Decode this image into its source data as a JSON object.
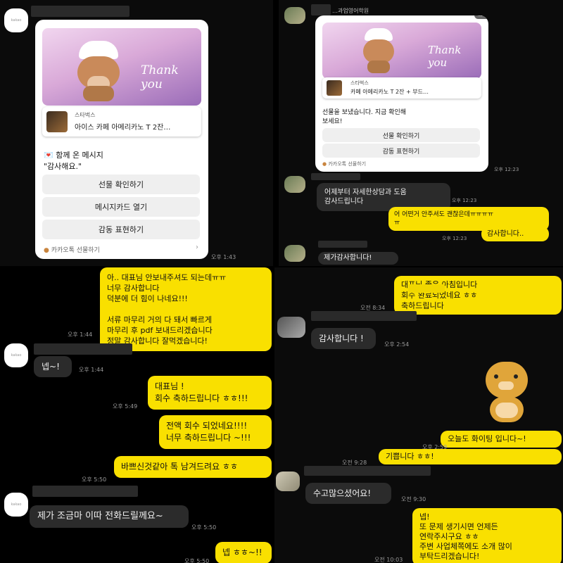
{
  "top_left": {
    "card": {
      "badge": "kakao",
      "thank_you": "Thank you",
      "brand": "스타벅스",
      "product": "아이스 카페 아메리카노 T 2잔…",
      "message_heading": "함께 온 메시지",
      "message_text": "\"감사해요.\"",
      "buttons": [
        "선물 확인하기",
        "메시지카드 열기",
        "감동 표현하기"
      ],
      "footer": "카카오톡 선물하기"
    },
    "card_time": "오후 1:43",
    "messages": [
      {
        "text": "아.. 대표님 안보내주셔도 되는데ㅠㅠ\n너무 감사합니다\n덕분에 더 힘이 나네요!!!\n\n서류 마무리 거의 다 돼서 빠르게\n마무리 후 pdf 보내드리겠습니다\n정말 감사합니다 잘먹겠습니다!",
        "time": "오후 1:44"
      },
      {
        "text": "넵~!",
        "time": "오후 1:44"
      }
    ]
  },
  "bottom_left": {
    "messages": [
      {
        "text": "대표님 !\n회수 축하드립니다 ㅎㅎ!!!",
        "time": "오후 5:49"
      },
      {
        "text": "전액 회수 되었네요!!!!\n너무 축하드립니다 ~!!!",
        "time": ""
      },
      {
        "text": "바쁘신것같아 톡 남겨드려요 ㅎㅎ",
        "time": "오후 5:50"
      },
      {
        "text": "제가 조금마 이따 전화드릴께요~",
        "time": "오후 5:50"
      },
      {
        "text": "넵 ㅎㅎ~!!",
        "time": "오후 5:50"
      }
    ]
  },
  "top_right": {
    "sender": "…과업영어학원",
    "card": {
      "badge": "kakao",
      "thank_you": "Thank you",
      "brand": "스타벅스",
      "product": "카페 아메리카노 T 2잔 + 부드…",
      "message_text": "선물을 보냈습니다. 지금 확인해\n보세요!",
      "buttons": [
        "선물 확인하기",
        "감동 표현하기"
      ],
      "footer": "카카오톡 선물하기"
    },
    "card_time": "오후 12:23",
    "messages": [
      {
        "text": "어제부터 자세한상담과 도움\n감사드립니다",
        "time": "오후 12:23"
      },
      {
        "text": "어 어떤거 안주셔도 괜찮은데ㅠㅠㅠㅠ\nㅠ",
        "time": "오후 12:23"
      },
      {
        "text": "감사합니다..",
        "time": ""
      },
      {
        "text": "제가감사합니다!",
        "time": "오후 12:23"
      }
    ]
  },
  "bottom_right": {
    "messages": [
      {
        "text": "대표님 좋은 아침입니다\n회수 완료되었네요 ㅎㅎ\n축하드립니다",
        "time": "오전 8:34"
      },
      {
        "text": "감사합니다 !",
        "time": "오후 2:54"
      },
      {
        "text": "오늘도 화이팅 입니다~!",
        "time": "오후 2:59"
      },
      {
        "text": "기쁩니다 ㅎㅎ!",
        "time": "오전 9:28"
      },
      {
        "text": "수고많으셨어요!",
        "time": "오전 9:30"
      },
      {
        "text": "넵!\n또 문제 생기시면 언제든\n연락주시구요 ㅎㅎ\n주변 사업체쪽에도 소개 많이\n부탁드리겠습니다!",
        "time": "오전 10:03"
      }
    ]
  },
  "colors": {
    "accent_bubble": "#f9e000",
    "dark_bubble": "#2b2b2b",
    "background": "#000000"
  }
}
